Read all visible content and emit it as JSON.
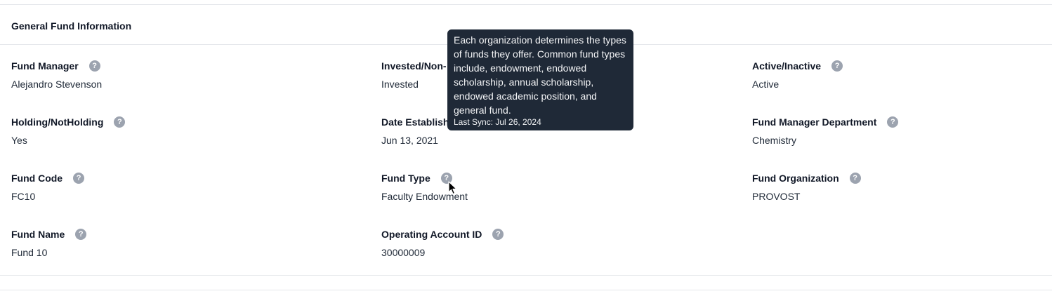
{
  "section": {
    "title": "General Fund Information"
  },
  "fields": {
    "fund_manager": {
      "label": "Fund Manager",
      "value": "Alejandro Stevenson"
    },
    "invested": {
      "label": "Invested/Non-",
      "value": "Invested"
    },
    "active": {
      "label": "Active/Inactive",
      "value": "Active"
    },
    "holding": {
      "label": "Holding/NotHolding",
      "value": "Yes"
    },
    "date_established": {
      "label": "Date Establish",
      "value": "Jun 13, 2021"
    },
    "fund_manager_department": {
      "label": "Fund Manager Department",
      "value": "Chemistry"
    },
    "fund_code": {
      "label": "Fund Code",
      "value": "FC10"
    },
    "fund_type": {
      "label": "Fund Type",
      "value": "Faculty Endowment"
    },
    "fund_organization": {
      "label": "Fund Organization",
      "value": "PROVOST"
    },
    "fund_name": {
      "label": "Fund Name",
      "value": "Fund 10"
    },
    "operating_account_id": {
      "label": "Operating Account ID",
      "value": "30000009"
    }
  },
  "help_icon": {
    "glyph": "?",
    "icon": "question-circle-icon"
  },
  "tooltip": {
    "body": "Each organization determines the types of funds they offer. Common fund types include, endowment, endowed scholarship, annual scholarship, endowed academic position, and general fund.",
    "last_sync": "Last Sync: Jul 26, 2024"
  }
}
